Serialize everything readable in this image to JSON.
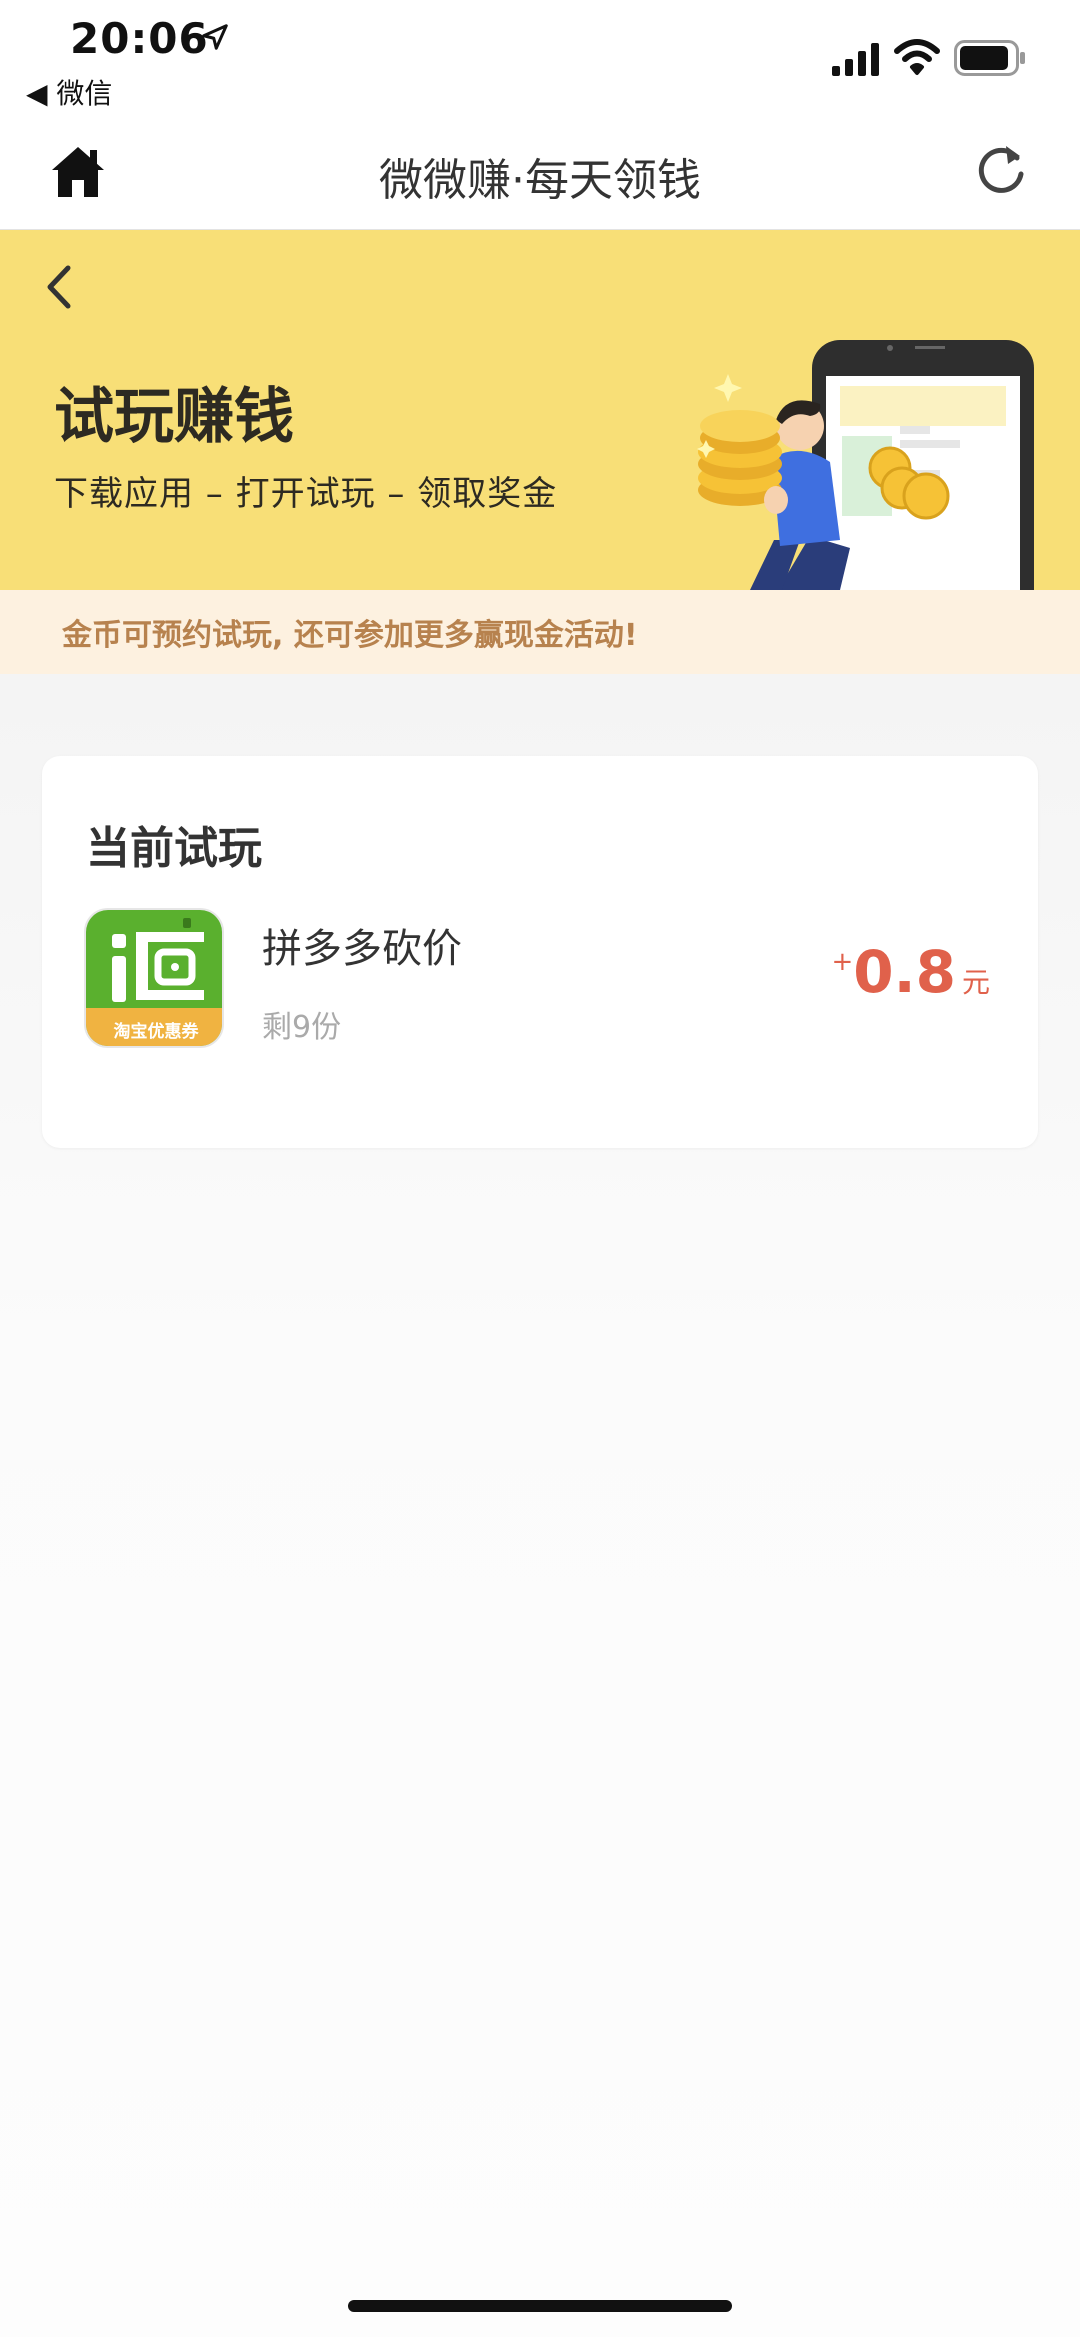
{
  "status_bar": {
    "time": "20:06",
    "back_app": "◀ 微信"
  },
  "nav": {
    "title": "微微赚·每天领钱"
  },
  "banner": {
    "title": "试玩赚钱",
    "subtitle": "下载应用 – 打开试玩 – 领取奖金",
    "background_color": "#f8df77"
  },
  "notice": {
    "text": "金币可预约试玩, 还可参加更多赢现金活动!",
    "text_color": "#b7824e"
  },
  "current_trial": {
    "title": "当前试玩",
    "app": {
      "icon_caption": "淘宝优惠券",
      "name": "拼多多砍价",
      "remaining": "剩9份",
      "reward_plus": "+",
      "reward_amount": "0.8",
      "reward_unit": "元"
    },
    "reward_color": "#e0614b"
  }
}
